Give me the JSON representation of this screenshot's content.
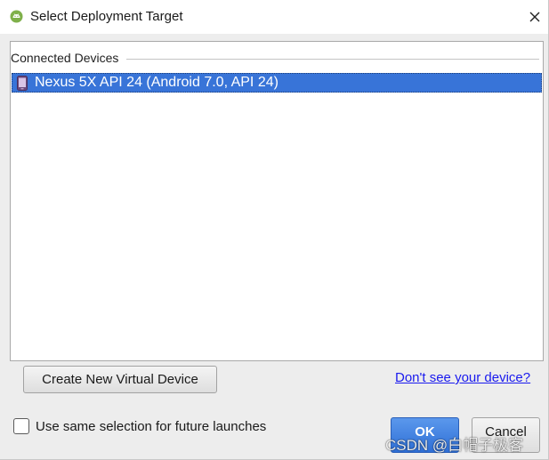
{
  "window": {
    "title": "Select Deployment Target",
    "app_icon": "android-icon",
    "close_icon": "close-icon"
  },
  "device_list": {
    "section_header": "Connected Devices",
    "devices": [
      {
        "label": "Nexus 5X API 24 (Android 7.0, API 24)",
        "icon": "phone-device-icon",
        "selected": true
      }
    ]
  },
  "actions": {
    "create_virtual_device_label": "Create New Virtual Device",
    "help_link_label": "Don't see your device?",
    "same_selection_label": "Use same selection for future launches",
    "same_selection_checked": false,
    "ok_label": "OK",
    "cancel_label": "Cancel"
  },
  "watermark": "CSDN @白帽子极客",
  "colors": {
    "selection": "#3874d8",
    "primary_button": "#2f6fd6",
    "link": "#1a1aee"
  }
}
